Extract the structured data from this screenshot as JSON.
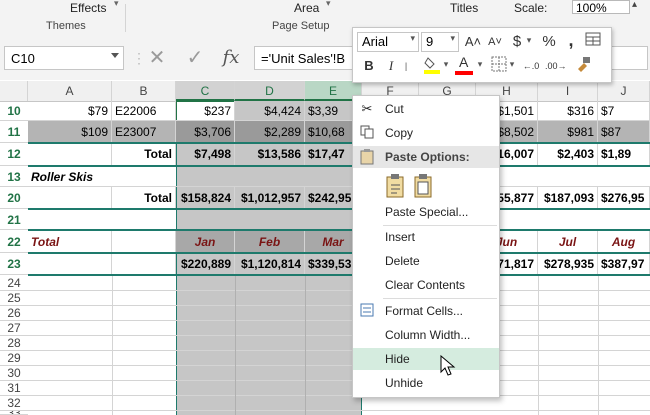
{
  "ribbon": {
    "effects_label": "Effects",
    "themes_group": "Themes",
    "area_label": "Area",
    "page_setup_group": "Page Setup",
    "titles_label": "Titles",
    "scale_label": "Scale:",
    "scale_value": "100%"
  },
  "formula_bar": {
    "name_box": "C10",
    "cancel_icon": "✕",
    "enter_icon": "✓",
    "fx_label": "fx",
    "formula": "='Unit Sales'!B"
  },
  "columns": [
    "A",
    "B",
    "C",
    "D",
    "E",
    "F",
    "G",
    "H",
    "I",
    "J"
  ],
  "rows": [
    {
      "num": "10",
      "A": "$79",
      "B": "E22006",
      "C": "$237",
      "D": "$4,424",
      "E": "$3,39",
      "H": "$1,501",
      "I": "$316",
      "J": "$7"
    },
    {
      "num": "11",
      "A": "$109",
      "B": "E23007",
      "C": "$3,706",
      "D": "$2,289",
      "E": "$10,68",
      "H": "$8,502",
      "I": "$981",
      "J": "$87"
    },
    {
      "num": "12",
      "B": "Total",
      "C": "$7,498",
      "D": "$13,586",
      "E": "$17,47",
      "H": "516,007",
      "I": "$2,403",
      "J": "$1,89"
    },
    {
      "num": "13",
      "A": "Roller Skis"
    },
    {
      "num": "20",
      "B": "Total",
      "C": "$158,824",
      "D": "$1,012,957",
      "E": "$242,95",
      "H": "355,877",
      "I": "$187,093",
      "J": "$276,95"
    },
    {
      "num": "21"
    },
    {
      "num": "22",
      "A": "Total",
      "C": "Jan",
      "D": "Feb",
      "E": "Mar",
      "H": "Jun",
      "I": "Jul",
      "J": "Aug"
    },
    {
      "num": "23",
      "C": "$220,889",
      "D": "$1,120,814",
      "E": "$339,53",
      "H": "371,817",
      "I": "$278,935",
      "J": "$387,97"
    },
    {
      "num": "24"
    },
    {
      "num": "25"
    },
    {
      "num": "26"
    },
    {
      "num": "27"
    },
    {
      "num": "28"
    },
    {
      "num": "29"
    },
    {
      "num": "30"
    },
    {
      "num": "31"
    },
    {
      "num": "32"
    },
    {
      "num": "33"
    }
  ],
  "mini_toolbar": {
    "font": "Arial",
    "size": "9",
    "grow_icon": "A˄",
    "shrink_icon": "A˅",
    "currency": "$",
    "percent": "%",
    "comma": ",",
    "bold": "B",
    "italic": "I",
    "font_color_letter": "A",
    "fill_color": "#ffff00",
    "font_color": "#ff0000"
  },
  "context_menu": {
    "cut": "Cut",
    "copy": "Copy",
    "paste_options": "Paste Options:",
    "paste_special": "Paste Special...",
    "insert": "Insert",
    "delete": "Delete",
    "clear_contents": "Clear Contents",
    "format_cells": "Format Cells...",
    "column_width": "Column Width...",
    "hide": "Hide",
    "unhide": "Unhide"
  }
}
